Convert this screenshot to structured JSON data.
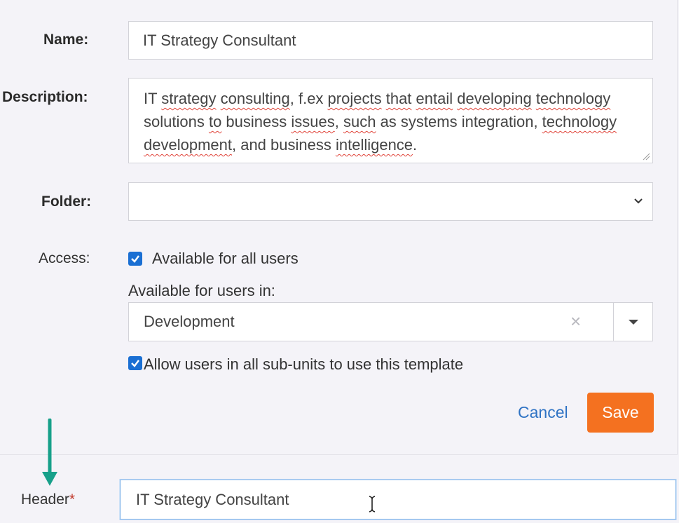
{
  "form": {
    "name": {
      "label": "Name:",
      "value": "IT Strategy Consultant"
    },
    "description": {
      "label": "Description:",
      "words": [
        [
          "IT",
          false
        ],
        [
          " ",
          false
        ],
        [
          "strategy",
          true
        ],
        [
          " ",
          false
        ],
        [
          "consulting",
          true
        ],
        [
          ", f.ex ",
          false
        ],
        [
          "projects",
          true
        ],
        [
          " ",
          false
        ],
        [
          "that",
          true
        ],
        [
          " ",
          false
        ],
        [
          "entail",
          true
        ],
        [
          " ",
          false
        ],
        [
          "developing",
          true
        ],
        [
          " ",
          false
        ],
        [
          "technology",
          true
        ],
        [
          " solutions ",
          false
        ],
        [
          "to",
          true
        ],
        [
          " business ",
          false
        ],
        [
          "issues",
          true
        ],
        [
          ", ",
          false
        ],
        [
          "such",
          true
        ],
        [
          " as systems integration, ",
          false
        ],
        [
          "technology",
          true
        ],
        [
          " ",
          false
        ],
        [
          "development",
          true
        ],
        [
          ", and business ",
          false
        ],
        [
          "intelligence",
          true
        ],
        [
          ".",
          false
        ]
      ]
    },
    "folder": {
      "label": "Folder:",
      "value": ""
    },
    "access": {
      "label": "Access:",
      "available_all_label": "Available for all users",
      "available_all_checked": true,
      "available_in_label": "Available for users in:",
      "unit_value": "Development",
      "clear_symbol": "×",
      "subunits_label": "Allow users in all sub-units to use this template",
      "subunits_checked": true
    },
    "actions": {
      "cancel_label": "Cancel",
      "save_label": "Save"
    }
  },
  "header_field": {
    "label": "Header",
    "required_mark": "*",
    "value": "IT Strategy Consultant"
  },
  "colors": {
    "accent_blue": "#1a6fd3",
    "save_orange": "#f47120",
    "link_blue": "#2f73c4",
    "arrow_teal": "#17a08a"
  }
}
